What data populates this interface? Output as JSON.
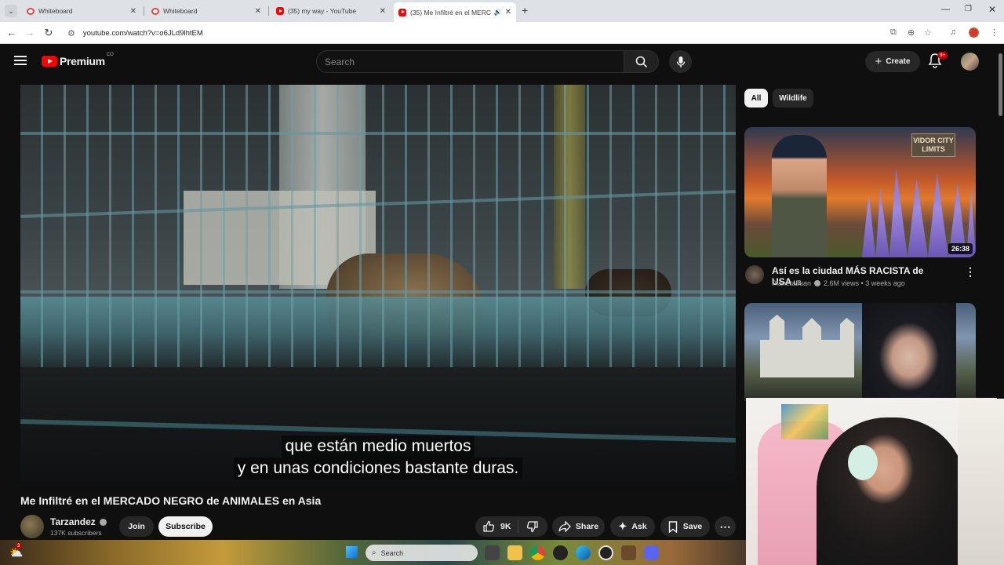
{
  "browser": {
    "tabs": [
      {
        "title": "Whiteboard",
        "favicon": "whiteboard-icon",
        "active": false
      },
      {
        "title": "Whiteboard",
        "favicon": "whiteboard-icon",
        "active": false
      },
      {
        "title": "(35) my way - YouTube",
        "favicon": "youtube-icon",
        "active": false
      },
      {
        "title": "(35) Me Infiltré en el MERC",
        "favicon": "youtube-icon",
        "active": true
      }
    ],
    "url": "youtube.com/watch?v=o6JLd9lhtEM"
  },
  "yt": {
    "logo_text": "Premium",
    "country_code": "CO",
    "search_placeholder": "Search",
    "create_label": "Create",
    "notifications_badge": "9+"
  },
  "video": {
    "subtitle_line1": "que están medio muertos",
    "subtitle_line2": "y en unas condiciones bastante duras.",
    "title": "Me Infiltré en el MERCADO NEGRO de ANIMALES en Asia",
    "channel": "Tarzandez",
    "subscribers": "137K subscribers",
    "join_label": "Join",
    "subscribe_label": "Subscribe",
    "likes": "9K",
    "share_label": "Share",
    "ask_label": "Ask",
    "save_label": "Save"
  },
  "sidebar": {
    "chips": [
      {
        "label": "All",
        "selected": true
      },
      {
        "label": "Wildlife",
        "selected": false
      }
    ],
    "recs": [
      {
        "title": "Así es la ciudad MÁS RACISTA de USA",
        "title_suffix": "us",
        "channel": "PlanetaJuan",
        "meta": "2.6M views • 3 weeks ago",
        "duration": "26:38",
        "sign_text": "VIDOR CITY LIMITS"
      }
    ]
  },
  "taskbar": {
    "search_placeholder": "Search",
    "notification_count": "3"
  },
  "colors": {
    "yt_red": "#ff0000",
    "background": "#0f0f0f",
    "chip_bg": "#272727"
  }
}
